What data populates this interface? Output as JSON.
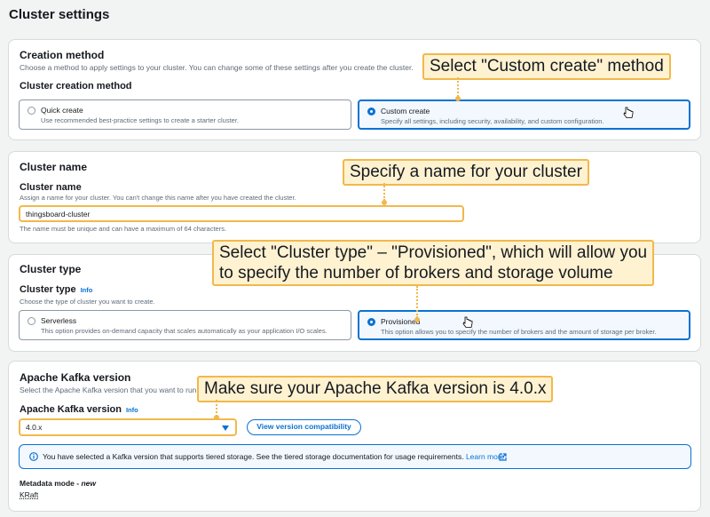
{
  "page": {
    "title": "Cluster settings"
  },
  "creation": {
    "heading": "Creation method",
    "description": "Choose a method to apply settings to your cluster. You can change some of these settings after you create the cluster.",
    "subheading": "Cluster creation method",
    "options": [
      {
        "title": "Quick create",
        "description": "Use recommended best-practice settings to create a starter cluster.",
        "selected": false
      },
      {
        "title": "Custom create",
        "description": "Specify all settings, including security, availability, and custom configuration.",
        "selected": true
      }
    ],
    "callout": "Select \"Custom create\" method"
  },
  "name": {
    "heading": "Cluster name",
    "label": "Cluster name",
    "description": "Assign a name for your cluster. You can't change this name after you have created the cluster.",
    "value": "thingsboard-cluster",
    "constraint": "The name must be unique and can have a maximum of 64 characters.",
    "callout": "Specify a name for your cluster"
  },
  "type": {
    "heading": "Cluster type",
    "label": "Cluster type",
    "info": "Info",
    "description": "Choose the type of cluster you want to create.",
    "options": [
      {
        "title": "Serverless",
        "description": "This option provides on-demand capacity that scales automatically as your application I/O scales.",
        "selected": false
      },
      {
        "title": "Provisioned",
        "description": "This option allows you to specify the number of brokers and the amount of storage per broker.",
        "selected": true
      }
    ],
    "callout_line1": "Select \"Cluster type\" – \"Provisioned\", which will allow you",
    "callout_line2": "to specify the number of brokers and storage volume"
  },
  "kafka": {
    "heading": "Apache Kafka version",
    "description": "Select the Apache Kafka version that you want to run",
    "label": "Apache Kafka version",
    "info": "Info",
    "selected_version": "4.0.x",
    "compat_button": "View version compatibility",
    "alert_text": "You have selected a Kafka version that supports tiered storage. See the tiered storage documentation for usage requirements.",
    "learn_more": "Learn more",
    "metadata_label": "Metadata mode",
    "metadata_tag": "new",
    "metadata_value": "KRaft",
    "callout": "Make sure your Apache Kafka version is 4.0.x"
  },
  "colors": {
    "accent": "#0972d3",
    "callout_bg": "#fef2d1",
    "callout_border": "#f2b84b"
  }
}
